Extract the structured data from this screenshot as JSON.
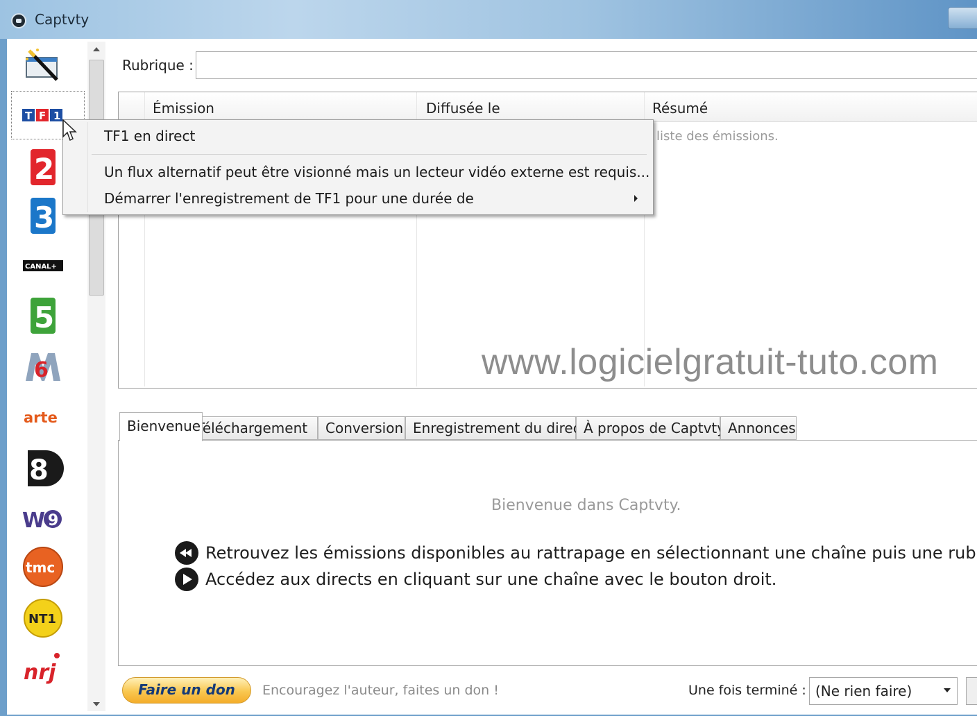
{
  "window": {
    "title": "Captvty"
  },
  "sidebar": {
    "channels": [
      {
        "id": "wizard",
        "icon": "magic-wand-icon"
      },
      {
        "id": "tf1",
        "label": "TF1",
        "color": "#1d4ea3"
      },
      {
        "id": "france2",
        "label": "2",
        "color": "#e2262c"
      },
      {
        "id": "france3",
        "label": "3",
        "color": "#1b77c9"
      },
      {
        "id": "canalplus",
        "label": "CANAL+",
        "color": "#111111"
      },
      {
        "id": "france5",
        "label": "5",
        "color": "#3ea33a"
      },
      {
        "id": "m6",
        "label": "M6",
        "color": "#d8232a"
      },
      {
        "id": "arte",
        "label": "arte",
        "color": "#e45a1b"
      },
      {
        "id": "d8",
        "label": "8",
        "color": "#1a1a1a"
      },
      {
        "id": "w9",
        "label": "W9",
        "color": "#4a3c8c"
      },
      {
        "id": "tmc",
        "label": "TMC",
        "color": "#e86222"
      },
      {
        "id": "nt1",
        "label": "NT1",
        "color": "#f3d11a"
      },
      {
        "id": "nrj12",
        "label": "NRJ",
        "color": "#d8232a"
      }
    ]
  },
  "rubrique": {
    "label": "Rubrique :",
    "value": ""
  },
  "emissions_list": {
    "columns": [
      "Émission",
      "Diffusée le",
      "Résumé"
    ],
    "empty_text": "liste des émissions.",
    "watermark": "www.logicielgratuit-tuto.com"
  },
  "context_menu": {
    "items": [
      "TF1 en direct",
      "Un flux alternatif peut être visionné mais un lecteur vidéo externe est requis...",
      "Démarrer l'enregistrement de TF1 pour une durée de"
    ]
  },
  "tabs": [
    {
      "label": "Bienvenue",
      "active": true
    },
    {
      "label": "Téléchargement",
      "active": false
    },
    {
      "label": "Conversion",
      "active": false
    },
    {
      "label": "Enregistrement du direct",
      "active": false
    },
    {
      "label": "À propos de Captvty",
      "active": false
    },
    {
      "label": "Annonces",
      "active": false
    }
  ],
  "welcome": {
    "title": "Bienvenue dans Captvty.",
    "lines": [
      {
        "icon": "rewind-icon",
        "text": "Retrouvez les émissions disponibles au rattrapage en sélectionnant une chaîne puis une rubrique."
      },
      {
        "icon": "play-icon",
        "text": "Accédez aux directs en cliquant sur une chaîne avec le bouton droit."
      }
    ]
  },
  "footer": {
    "donate_label": "Faire un don",
    "donate_text": "Encouragez l'auteur, faites un don !",
    "after_label": "Une fois terminé :",
    "after_value": "(Ne rien faire)"
  }
}
